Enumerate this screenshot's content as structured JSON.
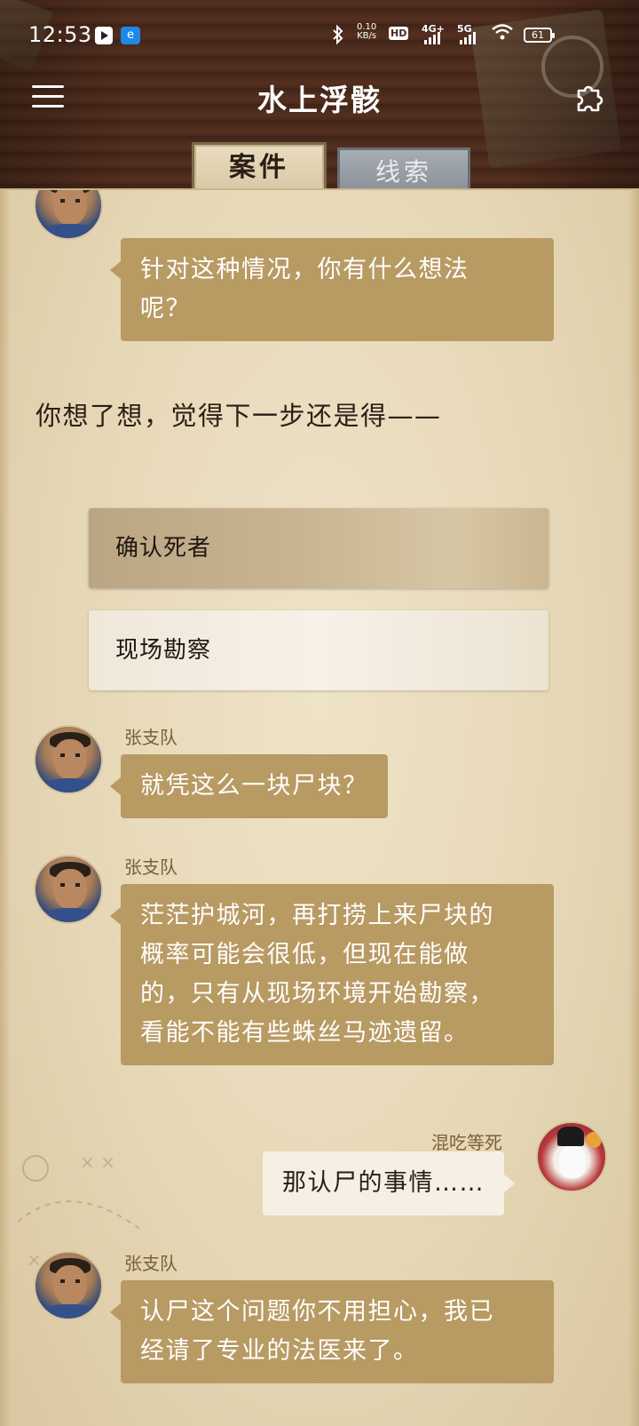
{
  "status_bar": {
    "time": "12:53",
    "net_speed_value": "0.10",
    "net_speed_unit": "KB/s",
    "hd_label": "HD",
    "network_4g": "4G+",
    "network_5g": "5G",
    "battery": "61"
  },
  "header": {
    "title": "水上浮骸",
    "tabs": [
      {
        "label": "案件",
        "active": true
      },
      {
        "label": "线索",
        "active": false
      }
    ]
  },
  "messages": {
    "m1": {
      "text_line1": "针对这种情况，你有什么想法",
      "text_line2": "呢？"
    },
    "narration": "你想了想，觉得下一步还是得——",
    "choices": [
      {
        "label": "确认死者",
        "selected": true
      },
      {
        "label": "现场勘察",
        "selected": false
      }
    ],
    "m2": {
      "speaker": "张支队",
      "text": "就凭这么一块尸块？"
    },
    "m3": {
      "speaker": "张支队",
      "line1": "茫茫护城河，再打捞上来尸块的",
      "line2": "概率可能会很低，但现在能做",
      "line3": "的，只有从现场环境开始勘察，",
      "line4": "看能不能有些蛛丝马迹遗留。"
    },
    "m4": {
      "speaker": "混吃等死",
      "text": "那认尸的事情……"
    },
    "m5": {
      "speaker": "张支队",
      "line1": "认尸这个问题你不用担心，我已",
      "line2": "经请了专业的法医来了。"
    }
  },
  "colors": {
    "bubble_npc": "#b89a63",
    "bubble_user": "#f6f0e4",
    "paper": "#e6d7b6",
    "speaker_text": "#7a6038"
  },
  "icons": [
    "menu-icon",
    "puzzle-icon",
    "bluetooth-icon",
    "wifi-icon",
    "battery-icon"
  ]
}
